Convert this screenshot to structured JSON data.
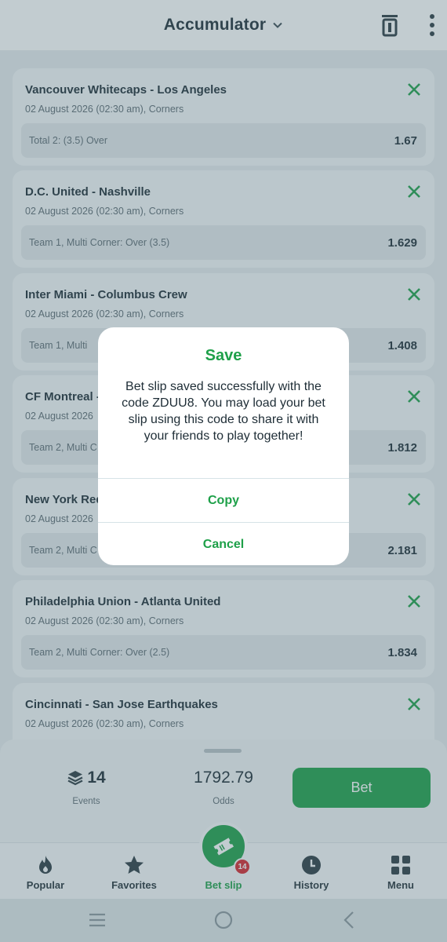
{
  "header": {
    "title": "Accumulator"
  },
  "cards": [
    {
      "match": "Vancouver Whitecaps - Los Angeles",
      "info": "02 August 2026 (02:30 am), Corners",
      "market": "Total 2: (3.5) Over",
      "odds": "1.67"
    },
    {
      "match": "D.C. United - Nashville",
      "info": "02 August 2026 (02:30 am), Corners",
      "market": "Team 1, Multi Corner: Over (3.5)",
      "odds": "1.629"
    },
    {
      "match": "Inter Miami - Columbus Crew",
      "info": "02 August 2026 (02:30 am), Corners",
      "market": "Team 1, Multi",
      "odds": "1.408"
    },
    {
      "match": "CF Montreal -",
      "info": "02 August 2026",
      "market": "Team 2, Multi C",
      "odds": "1.812"
    },
    {
      "match": "New York Red",
      "info": "02 August 2026",
      "market": "Team 2, Multi C",
      "odds": "2.181"
    },
    {
      "match": "Philadelphia Union - Atlanta United",
      "info": "02 August 2026 (02:30 am), Corners",
      "market": "Team 2, Multi Corner: Over (2.5)",
      "odds": "1.834"
    },
    {
      "match": "Cincinnati - San Jose Earthquakes",
      "info": "02 August 2026 (02:30 am), Corners",
      "market": "",
      "odds": ""
    }
  ],
  "summary": {
    "events_value": "14",
    "events_label": "Events",
    "odds_value": "1792.79",
    "odds_label": "Odds",
    "bet_label": "Bet"
  },
  "nav": {
    "items": [
      "Popular",
      "Favorites",
      "Bet slip",
      "History",
      "Menu"
    ],
    "badge": "14"
  },
  "dialog": {
    "title": "Save",
    "message": "Bet slip saved successfully with the code ZDUU8. You may load your bet slip using this code to share it with your friends to play together!",
    "copy_label": "Copy",
    "cancel_label": "Cancel"
  },
  "colors": {
    "accent": "#1ea049",
    "badge": "#d8262d",
    "text": "#1e2d36"
  }
}
